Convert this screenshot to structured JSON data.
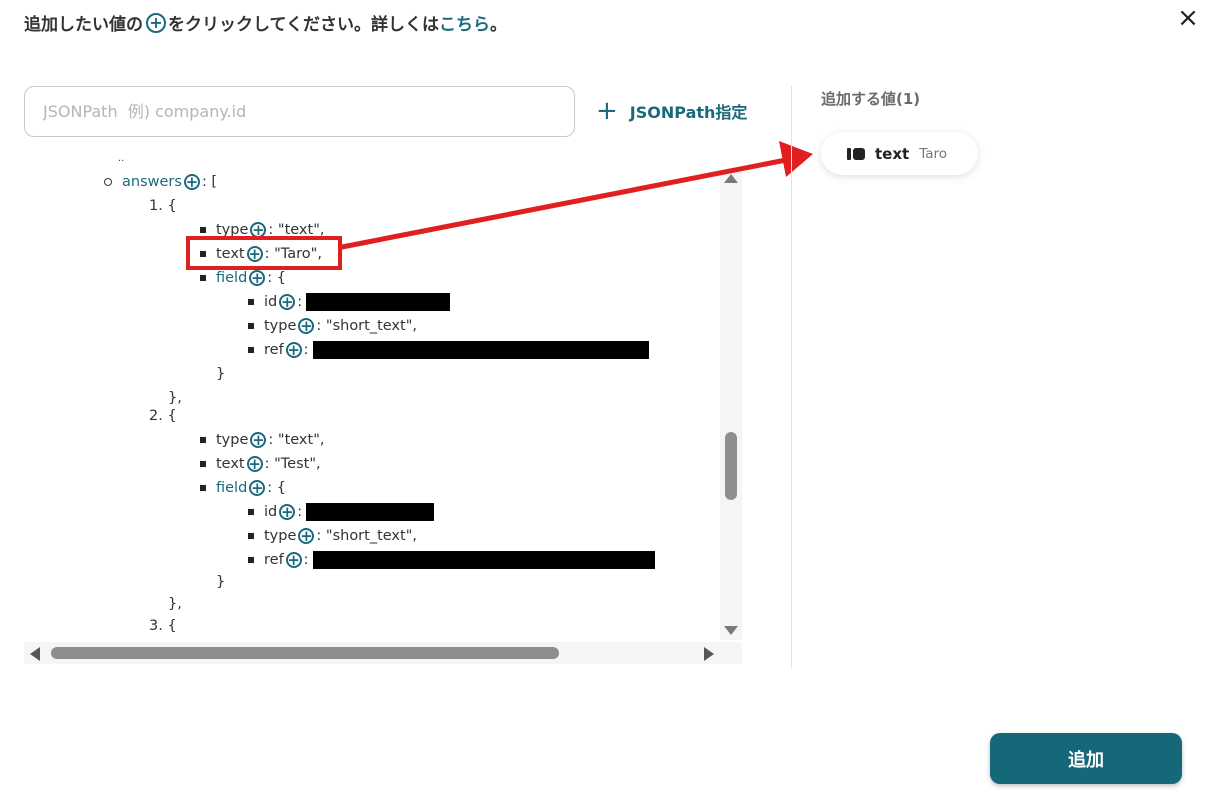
{
  "header": {
    "instruction_before": "追加したい値の",
    "instruction_after": "をクリックしてください。詳しくは",
    "instruction_link": "こちら",
    "instruction_end": "。",
    "close_icon": "×"
  },
  "search": {
    "placeholder": "JSONPath  例) company.id",
    "value": ""
  },
  "jsonpath_button": {
    "icon": "+",
    "label": "JSONPath指定"
  },
  "tree": {
    "add_icon": "+",
    "answers_key": "answers",
    "answers_open": ": [",
    "items": [
      {
        "index_label": "1. {",
        "type_key": "type",
        "type_value": ": \"text\",",
        "text_key": "text",
        "text_value": ": \"Taro\",",
        "field_key": "field",
        "field_open": ": {",
        "id_key": "id",
        "id_sep": ":",
        "ftype_key": "type",
        "ftype_value": ": \"short_text\",",
        "ref_key": "ref",
        "ref_sep": ":",
        "field_close": "}",
        "item_close": "},"
      },
      {
        "index_label": "2. {",
        "type_key": "type",
        "type_value": ": \"text\",",
        "text_key": "text",
        "text_value": ": \"Test\",",
        "field_key": "field",
        "field_open": ": {",
        "id_key": "id",
        "id_sep": ":",
        "ftype_key": "type",
        "ftype_value": ": \"short_text\",",
        "ref_key": "ref",
        "ref_sep": ":",
        "field_close": "}",
        "item_close": "},"
      }
    ],
    "item3_label": "3. {"
  },
  "selected": {
    "title": "追加する値(1)",
    "chips": [
      {
        "icon": "tag-icon",
        "key": "text",
        "value": "Taro"
      }
    ]
  },
  "add_button": {
    "label": "追加"
  },
  "colors": {
    "accent": "#15677a",
    "link": "#1a6a7c",
    "annotation": "#e02020"
  }
}
